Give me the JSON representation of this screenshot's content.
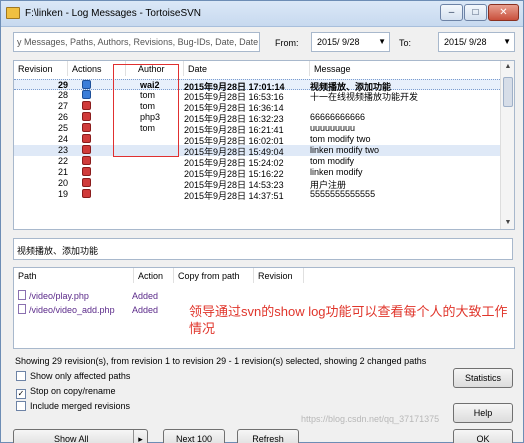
{
  "window": {
    "title": "F:\\linken - Log Messages - TortoiseSVN",
    "controls": {
      "minimize": "–",
      "maximize": "□",
      "close": "✕"
    }
  },
  "filter": {
    "placeholder": "y Messages, Paths, Authors, Revisions, Bug-IDs, Date, Date",
    "from_label": "From:",
    "from_date": "2015/ 9/28",
    "to_label": "To:",
    "to_date": "2015/ 9/28"
  },
  "log": {
    "columns": [
      "Revision",
      "Actions",
      "Author",
      "Date",
      "Message"
    ],
    "rows": [
      {
        "rev": "29",
        "action": "blue",
        "author": "wai2",
        "date": "2015年9月28日 17:01:14",
        "msg": "视频播放、添加功能"
      },
      {
        "rev": "28",
        "action": "blue",
        "author": "tom",
        "date": "2015年9月28日 16:53:16",
        "msg": "十一在线视频播放功能开发"
      },
      {
        "rev": "27",
        "action": "red",
        "author": "tom",
        "date": "2015年9月28日 16:36:14",
        "msg": ""
      },
      {
        "rev": "26",
        "action": "red",
        "author": "php3",
        "date": "2015年9月28日 16:32:23",
        "msg": "66666666666"
      },
      {
        "rev": "25",
        "action": "red",
        "author": "tom",
        "date": "2015年9月28日 16:21:41",
        "msg": "uuuuuuuuu"
      },
      {
        "rev": "24",
        "action": "red",
        "author": "",
        "date": "2015年9月28日 16:02:01",
        "msg": "tom modify two"
      },
      {
        "rev": "23",
        "action": "red",
        "author": "",
        "date": "2015年9月28日 15:49:04",
        "msg": "linken modify two"
      },
      {
        "rev": "22",
        "action": "red",
        "author": "",
        "date": "2015年9月28日 15:24:02",
        "msg": "tom modify"
      },
      {
        "rev": "21",
        "action": "red",
        "author": "",
        "date": "2015年9月28日 15:16:22",
        "msg": "linken modify"
      },
      {
        "rev": "20",
        "action": "red",
        "author": "",
        "date": "2015年9月28日 14:53:23",
        "msg": "用户注册"
      },
      {
        "rev": "19",
        "action": "red",
        "author": "",
        "date": "2015年9月28日 14:37:51",
        "msg": "5555555555555"
      }
    ]
  },
  "message_detail": "视频播放、添加功能",
  "paths": {
    "columns": [
      "Path",
      "Action",
      "Copy from path",
      "Revision"
    ],
    "rows": [
      {
        "path": "/video/play.php",
        "action": "Added"
      },
      {
        "path": "/video/video_add.php",
        "action": "Added"
      }
    ]
  },
  "annotation": "领导通过svn的show log功能可以查看每个人的大致工作情况",
  "status_text": "Showing 29 revision(s), from revision 1 to revision 29 - 1 revision(s) selected, showing 2 changed paths",
  "options": [
    {
      "label": "Show only affected paths",
      "checked": false
    },
    {
      "label": "Stop on copy/rename",
      "checked": true
    },
    {
      "label": "Include merged revisions",
      "checked": false
    }
  ],
  "buttons": {
    "statistics": "Statistics",
    "help": "Help",
    "show_all": "Show All",
    "next_100": "Next 100",
    "refresh": "Refresh",
    "ok": "OK"
  },
  "watermark": "https://blog.csdn.net/qq_37171375"
}
